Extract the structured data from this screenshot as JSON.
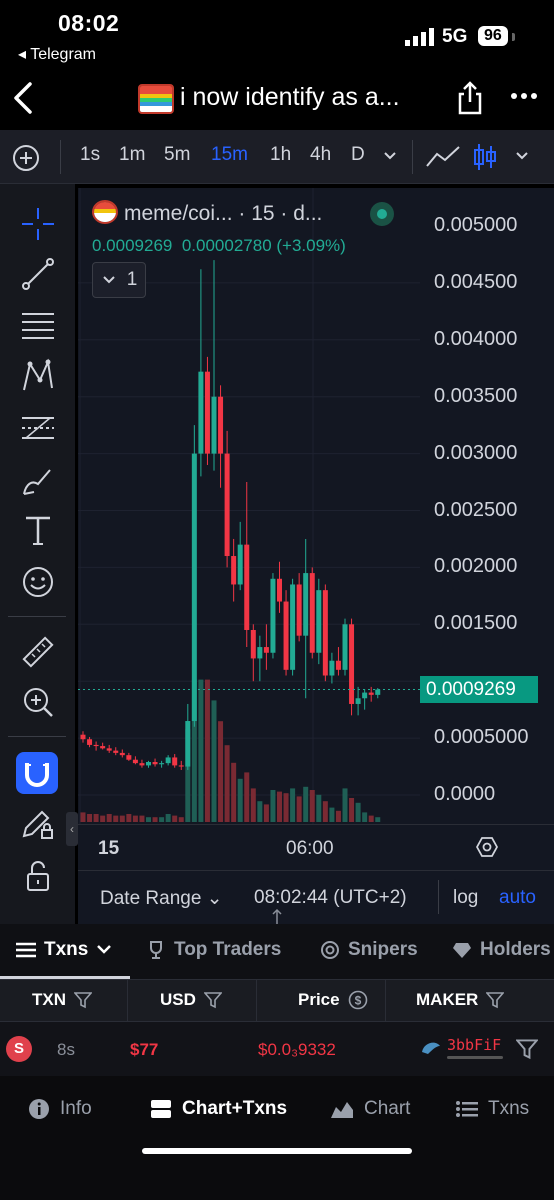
{
  "status": {
    "time": "08:02",
    "back_app": "◂ Telegram",
    "network": "5G",
    "battery": "96"
  },
  "header": {
    "title": "i now identify as a..."
  },
  "toolbar": {
    "timeframes": [
      "1s",
      "1m",
      "5m",
      "15m",
      "1h",
      "4h",
      "D"
    ],
    "active_timeframe": "15m"
  },
  "legend": {
    "title": "meme/coi...  · 15 · d...",
    "price": "0.0009269",
    "change": "0.00002780 (+3.09%)",
    "collapse_count": "1"
  },
  "price_axis": [
    "0.005000",
    "0.004500",
    "0.004000",
    "0.003500",
    "0.003000",
    "0.002500",
    "0.002000",
    "0.001500",
    "0.0005000",
    "0.0000"
  ],
  "current_price_label": "0.0009269",
  "time_axis": [
    "15",
    "06:00"
  ],
  "range_bar": {
    "label": "Date Range ⌄",
    "time": "08:02:44 (UTC+2)",
    "log": "log",
    "auto": "auto"
  },
  "tabs": [
    "Txns",
    "Top Traders",
    "Snipers",
    "Holders"
  ],
  "table": {
    "headers": [
      "TXN",
      "USD",
      "Price",
      "MAKER"
    ],
    "row": {
      "side": "S",
      "age": "8s",
      "usd": "$77",
      "price": "$0.0₃9332",
      "maker": "3bbFiF"
    }
  },
  "bottom_nav": [
    "Info",
    "Chart+Txns",
    "Chart",
    "Txns"
  ],
  "colors": {
    "up": "#22ab94",
    "down": "#f23645",
    "accent": "#2962ff"
  },
  "chart_data": {
    "type": "candlestick",
    "timeframe": "15m",
    "ylim": [
      0,
      0.0052
    ],
    "current_price": 0.0009269,
    "candles": [
      {
        "o": 0.00053,
        "h": 0.00056,
        "l": 0.00046,
        "c": 0.00049,
        "v": 0.06
      },
      {
        "o": 0.00049,
        "h": 0.00051,
        "l": 0.00042,
        "c": 0.00044,
        "v": 0.05
      },
      {
        "o": 0.00044,
        "h": 0.00047,
        "l": 0.00039,
        "c": 0.00043,
        "v": 0.05
      },
      {
        "o": 0.00043,
        "h": 0.00046,
        "l": 0.0004,
        "c": 0.00041,
        "v": 0.04
      },
      {
        "o": 0.00041,
        "h": 0.00044,
        "l": 0.00037,
        "c": 0.00039,
        "v": 0.05
      },
      {
        "o": 0.00039,
        "h": 0.00042,
        "l": 0.00035,
        "c": 0.00037,
        "v": 0.04
      },
      {
        "o": 0.00037,
        "h": 0.0004,
        "l": 0.00033,
        "c": 0.00035,
        "v": 0.04
      },
      {
        "o": 0.00035,
        "h": 0.00037,
        "l": 0.0003,
        "c": 0.00031,
        "v": 0.05
      },
      {
        "o": 0.00031,
        "h": 0.00034,
        "l": 0.00027,
        "c": 0.00028,
        "v": 0.04
      },
      {
        "o": 0.00028,
        "h": 0.00031,
        "l": 0.00024,
        "c": 0.00026,
        "v": 0.04
      },
      {
        "o": 0.00026,
        "h": 0.0003,
        "l": 0.00024,
        "c": 0.00029,
        "v": 0.03
      },
      {
        "o": 0.00029,
        "h": 0.00032,
        "l": 0.00025,
        "c": 0.00027,
        "v": 0.03
      },
      {
        "o": 0.00027,
        "h": 0.0003,
        "l": 0.00024,
        "c": 0.00028,
        "v": 0.03
      },
      {
        "o": 0.00028,
        "h": 0.00035,
        "l": 0.00026,
        "c": 0.00033,
        "v": 0.05
      },
      {
        "o": 0.00033,
        "h": 0.00036,
        "l": 0.00024,
        "c": 0.00026,
        "v": 0.04
      },
      {
        "o": 0.00026,
        "h": 0.0003,
        "l": 0.00022,
        "c": 0.00025,
        "v": 0.03
      },
      {
        "o": 0.00025,
        "h": 0.0008,
        "l": 0.00022,
        "c": 0.00065,
        "v": 0.58
      },
      {
        "o": 0.00065,
        "h": 0.00325,
        "l": 0.0006,
        "c": 0.003,
        "v": 0.89
      },
      {
        "o": 0.003,
        "h": 0.00462,
        "l": 0.0028,
        "c": 0.00372,
        "v": 0.89
      },
      {
        "o": 0.00372,
        "h": 0.00385,
        "l": 0.0029,
        "c": 0.003,
        "v": 0.89
      },
      {
        "o": 0.003,
        "h": 0.0047,
        "l": 0.00285,
        "c": 0.0035,
        "v": 0.76
      },
      {
        "o": 0.0035,
        "h": 0.0036,
        "l": 0.0027,
        "c": 0.003,
        "v": 0.63
      },
      {
        "o": 0.003,
        "h": 0.0032,
        "l": 0.002,
        "c": 0.0021,
        "v": 0.48
      },
      {
        "o": 0.0021,
        "h": 0.00225,
        "l": 0.0017,
        "c": 0.00185,
        "v": 0.37
      },
      {
        "o": 0.00185,
        "h": 0.0024,
        "l": 0.0018,
        "c": 0.0022,
        "v": 0.27
      },
      {
        "o": 0.0022,
        "h": 0.00275,
        "l": 0.0013,
        "c": 0.00145,
        "v": 0.31
      },
      {
        "o": 0.00145,
        "h": 0.0015,
        "l": 0.001,
        "c": 0.0012,
        "v": 0.21
      },
      {
        "o": 0.0012,
        "h": 0.0014,
        "l": 0.001,
        "c": 0.0013,
        "v": 0.13
      },
      {
        "o": 0.0013,
        "h": 0.0015,
        "l": 0.0011,
        "c": 0.00125,
        "v": 0.11
      },
      {
        "o": 0.00125,
        "h": 0.00195,
        "l": 0.0012,
        "c": 0.0019,
        "v": 0.2
      },
      {
        "o": 0.0019,
        "h": 0.00205,
        "l": 0.0016,
        "c": 0.0017,
        "v": 0.19
      },
      {
        "o": 0.0017,
        "h": 0.0018,
        "l": 0.00105,
        "c": 0.0011,
        "v": 0.18
      },
      {
        "o": 0.0011,
        "h": 0.0019,
        "l": 0.00105,
        "c": 0.00185,
        "v": 0.21
      },
      {
        "o": 0.00185,
        "h": 0.00195,
        "l": 0.00135,
        "c": 0.0014,
        "v": 0.16
      },
      {
        "o": 0.0014,
        "h": 0.00225,
        "l": 0.00085,
        "c": 0.00195,
        "v": 0.22
      },
      {
        "o": 0.00195,
        "h": 0.002,
        "l": 0.0012,
        "c": 0.00125,
        "v": 0.2
      },
      {
        "o": 0.00125,
        "h": 0.0019,
        "l": 0.00115,
        "c": 0.0018,
        "v": 0.17
      },
      {
        "o": 0.0018,
        "h": 0.00185,
        "l": 0.001,
        "c": 0.00105,
        "v": 0.13
      },
      {
        "o": 0.00105,
        "h": 0.00125,
        "l": 0.00098,
        "c": 0.00118,
        "v": 0.09
      },
      {
        "o": 0.00118,
        "h": 0.0013,
        "l": 0.00105,
        "c": 0.0011,
        "v": 0.07
      },
      {
        "o": 0.0011,
        "h": 0.00155,
        "l": 0.00105,
        "c": 0.0015,
        "v": 0.21
      },
      {
        "o": 0.0015,
        "h": 0.00155,
        "l": 0.0007,
        "c": 0.0008,
        "v": 0.15
      },
      {
        "o": 0.0008,
        "h": 0.00095,
        "l": 0.0007,
        "c": 0.00085,
        "v": 0.12
      },
      {
        "o": 0.00085,
        "h": 0.00093,
        "l": 0.00075,
        "c": 0.0009,
        "v": 0.06
      },
      {
        "o": 0.0009,
        "h": 0.00095,
        "l": 0.00082,
        "c": 0.00088,
        "v": 0.04
      },
      {
        "o": 0.00088,
        "h": 0.00094,
        "l": 0.00085,
        "c": 0.0009269,
        "v": 0.03
      }
    ]
  }
}
